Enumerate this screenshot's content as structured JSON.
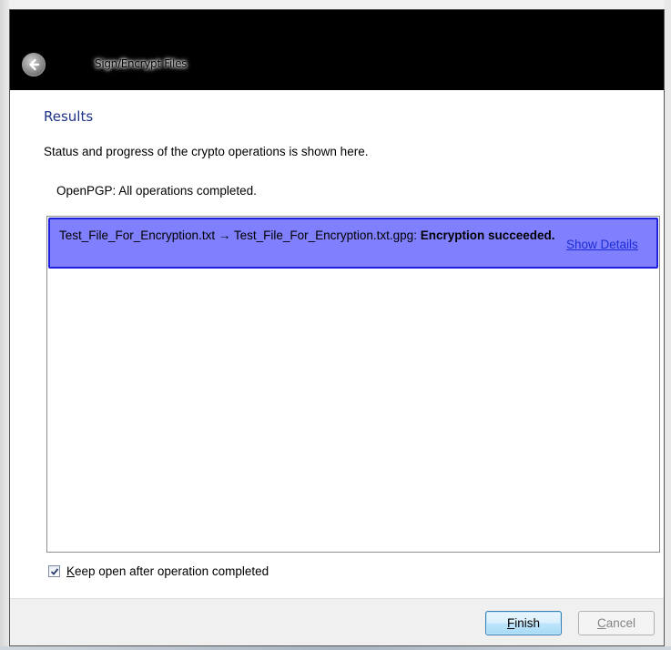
{
  "window": {
    "title": "Sign/Encrypt Files"
  },
  "page": {
    "section_title": "Results",
    "description": "Status and progress of the crypto operations is shown here.",
    "status": "OpenPGP: All operations completed."
  },
  "results": [
    {
      "source": "Test_File_For_Encryption.txt",
      "arrow": " → ",
      "target": "Test_File_For_Encryption.txt.gpg: ",
      "outcome": "Encryption succeeded.",
      "details_link": "Show Details"
    }
  ],
  "options": {
    "keep_open_mnemonic": "K",
    "keep_open_rest": "eep open after operation completed",
    "keep_open_checked": true
  },
  "buttons": {
    "finish_mnemonic": "F",
    "finish_rest": "inish",
    "cancel_mnemonic": "C",
    "cancel_rest": "ancel"
  },
  "colors": {
    "titlebar": "#000000",
    "section_title": "#1e3287",
    "selected_item": "#8080ff",
    "selected_border": "#1f1fe0",
    "link": "#1d2dd1"
  },
  "icons": {
    "back": "back-arrow-icon",
    "checkbox": "checkmark-icon"
  }
}
